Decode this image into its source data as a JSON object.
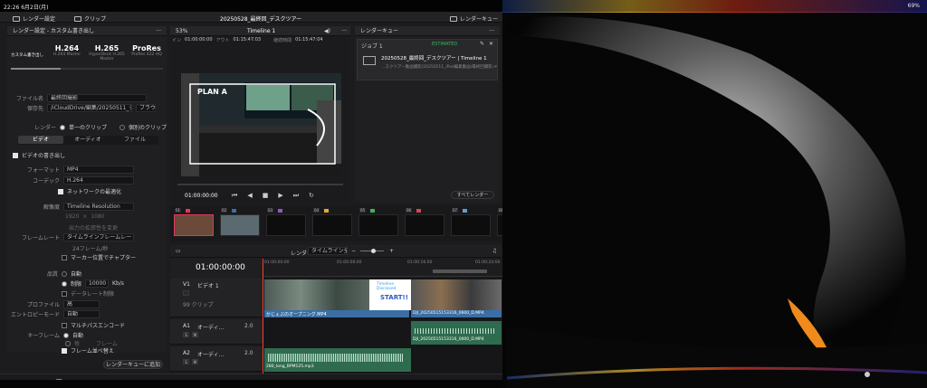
{
  "status_bar": {
    "time_date": "22:26  6月2日(月)",
    "right": "69%"
  },
  "toolbar": {
    "render_settings": "レンダー設定",
    "clips": "クリップ",
    "project_title": "20250528_最終回_デスクツアー",
    "render_queue": "レンダーキュー"
  },
  "render_settings": {
    "title": "レンダー設定 - カスタム書き出し",
    "presets": [
      {
        "name": "H.264",
        "sub": "H.264 Master"
      },
      {
        "name": "H.265",
        "sub": "H.265 Master"
      },
      {
        "name": "ProRes",
        "sub": "ProRes 422 HQ"
      }
    ],
    "preset_left_sub": "カスタム書き出し",
    "preset_mid_sub": "HyperDeck",
    "filename_label": "ファイル名",
    "filename_value": "最終回撮影",
    "location_label": "保存先",
    "location_value": "/iCloudDrive/編集/20250511_デスクツアー動画撮影",
    "browse": "ブラウズ",
    "render_label": "レンダー",
    "single_clip": "単一のクリップ",
    "individual_clips": "個別のクリップ",
    "tabs": [
      "ビデオ",
      "オーディオ",
      "ファイル"
    ],
    "export_video": "ビデオの書き出し",
    "format_label": "フォーマット",
    "format_value": "MP4",
    "codec_label": "コーデック",
    "codec_value": "H.264",
    "network_opt": "ネットワークの最適化",
    "resolution_label": "解像度",
    "resolution_value": "Timeline Resolution",
    "res_w": "1920",
    "res_h": "1080",
    "pixel_note": "出力の拡張性を変更",
    "framerate_label": "フレームレート",
    "framerate_value": "タイムラインフレームレート",
    "fps_note": "24フレーム/秒",
    "frame_duplication": "マーカー位置でチャプター",
    "quality_label": "品質",
    "auto": "自動",
    "limit": "制限",
    "limit_value": "10000",
    "kbps": "Kb/s",
    "data_level": "データレート制限",
    "profile_label": "プロファイル",
    "profile_value": "高",
    "entropy_label": "エントロピーモード",
    "entropy_value": "自動",
    "multipass": "マルチパスエンコード",
    "keyframe_label": "キーフレーム",
    "keyframe_auto": "自動",
    "keyframe_every": "毎",
    "keyframe_frames": "フレーム",
    "frame_reorder": "フレーム並べ替え",
    "add_queue": "レンダーキューに追加"
  },
  "viewer": {
    "zoom": "53%",
    "timeline_name": "Timeline 1",
    "in_label": "イン",
    "in_tc": "01:00:00:00",
    "out_label": "アウト",
    "out_tc": "01:15:47:03",
    "dur_label": "継続時間",
    "dur_tc": "01:15:47:04",
    "overlay_text": "PLAN A",
    "timecode": "01:00:00:00"
  },
  "render_queue": {
    "title": "レンダーキュー",
    "job": "ジョブ 1",
    "job_status": "ESTIMATED",
    "job_title": "20250528_最終回_デスクツアー | Timeline 1",
    "job_path": "…スクツアー動画撮影/20250511_iPad編集動画/最終回撮影.mp4",
    "render_all": "すべてレンダー"
  },
  "thumbs": [
    "01",
    "02",
    "03",
    "04",
    "05",
    "06",
    "07",
    "08",
    "09"
  ],
  "timeline": {
    "timecode": "01:00:00:00",
    "render_label": "レンダー",
    "render_mode": "タイムライン全体",
    "ruler": [
      "01:00:00:00",
      "01:00:08:00",
      "01:00:16:00",
      "01:00:24:00"
    ],
    "tracks": [
      {
        "id": "V1",
        "name": "ビデオ 1",
        "count": "99 クリップ"
      },
      {
        "id": "A1",
        "name": "オーディ…",
        "vol": "2.0"
      },
      {
        "id": "A2",
        "name": "オーディ…",
        "vol": "2.0"
      }
    ],
    "clips": {
      "v1a": "かじぇぶのオープニング.MP4",
      "v1b": "DJI_20250515153316_0600_D.MP4",
      "title_card_top": "Timeline Disclosed",
      "title_card": "START!!",
      "a1": "DJI_20250515153316_0600_D.MP4",
      "a2": "280_long_BPM125.mp3"
    }
  },
  "colors": {
    "accent": "#e2365a",
    "video_clip": "#3a6ea5",
    "audio_clip": "#2f6b4f",
    "playhead": "#ff3b30"
  }
}
